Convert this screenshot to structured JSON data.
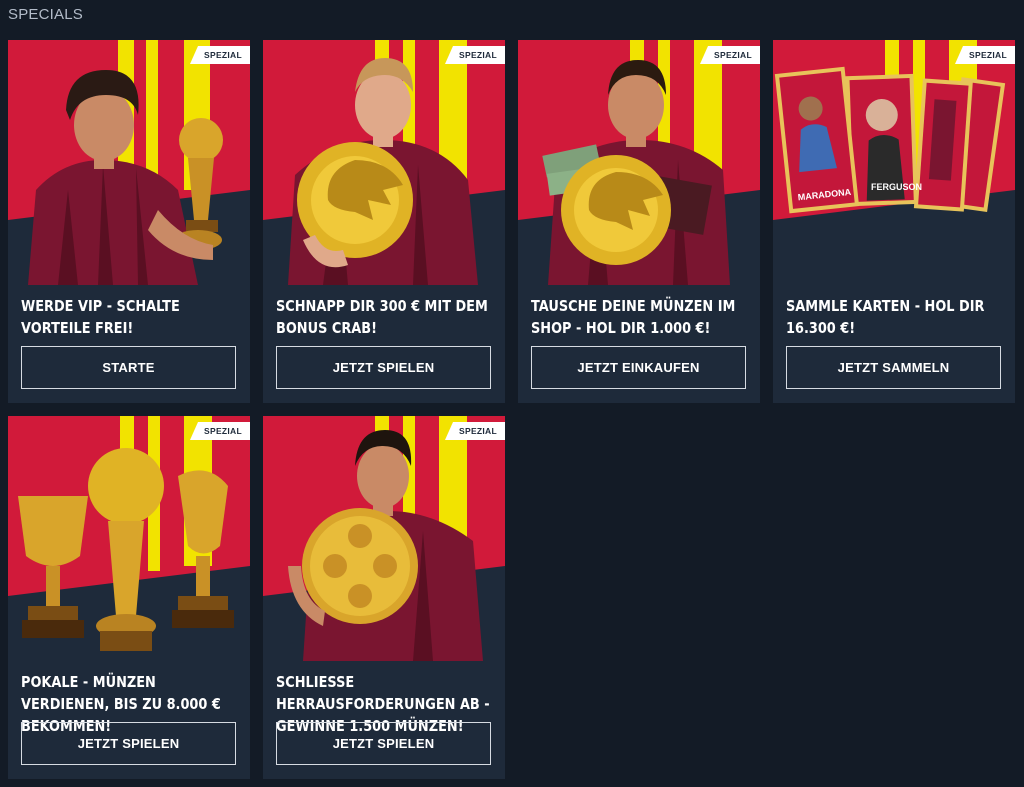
{
  "section": {
    "title": "SPECIALS"
  },
  "colors": {
    "background": "#131b26",
    "card": "#1e2a3a",
    "red": "#d11a3a",
    "yellow": "#f2e300"
  },
  "cards": [
    {
      "badge": "SPEZIAL",
      "title": "WERDE VIP - SCHALTE VORTEILE FREI!",
      "button": "STARTE",
      "art": "player-with-trophy"
    },
    {
      "badge": "SPEZIAL",
      "title": "SCHNAPP DIR 300 € MIT DEM BONUS CRAB!",
      "button": "JETZT SPIELEN",
      "art": "player-with-crab-coin"
    },
    {
      "badge": "SPEZIAL",
      "title": "TAUSCHE DEINE MÜNZEN IM SHOP - HOL DIR 1.000 €!",
      "button": "JETZT EINKAUFEN",
      "art": "player-with-coin-and-cash"
    },
    {
      "badge": "SPEZIAL",
      "title": "SAMMLE KARTEN - HOL DIR 16.300 €!",
      "button": "JETZT SAMMELN",
      "art": "player-cards",
      "card_labels": [
        "MARADONA",
        "FERGUSON"
      ]
    },
    {
      "badge": "SPEZIAL",
      "title": "POKALE - MÜNZEN VERDIENEN, BIS ZU 8.000 € BEKOMMEN!",
      "button": "JETZT SPIELEN",
      "art": "trophies"
    },
    {
      "badge": "SPEZIAL",
      "title": "SCHLIESSE HERRAUSFORDERUNGEN AB - GEWINNE 1.500 MÜNZEN!",
      "button": "JETZT SPIELEN",
      "art": "player-with-ball-coin"
    }
  ]
}
